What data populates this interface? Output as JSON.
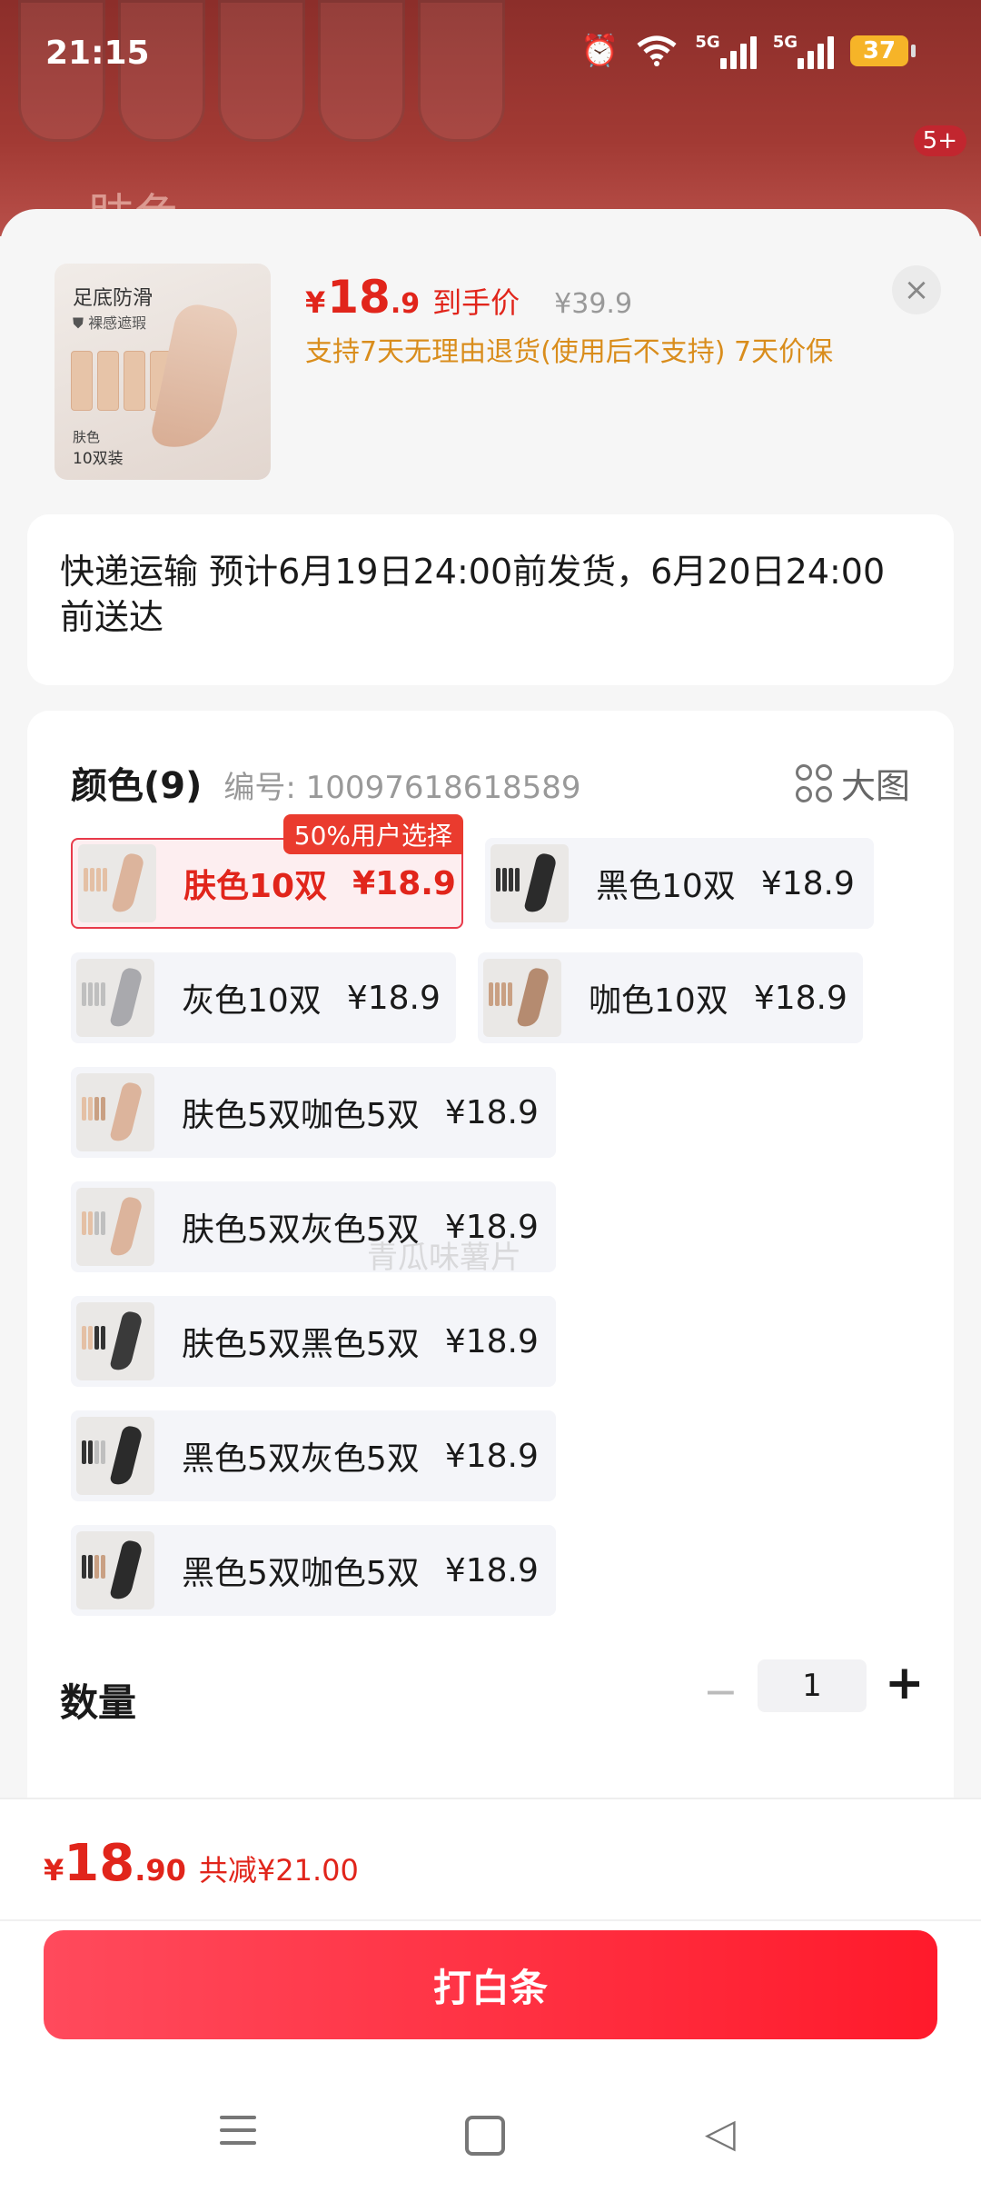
{
  "status_bar": {
    "time": "21:15",
    "signal_label": "5G",
    "battery": "37"
  },
  "background": {
    "color_text": "肤色",
    "badge": "5+"
  },
  "product": {
    "image": {
      "title": "足底防滑",
      "subtitle": "裸感遮瑕",
      "color": "肤色",
      "pack": "10双装"
    },
    "price_symbol": "¥",
    "price_int": "18",
    "price_dec": ".9",
    "price_label": "到手价",
    "original_price": "¥39.9",
    "policy": "支持7天无理由退货(使用后不支持) 7天价保",
    "close_icon": "×"
  },
  "delivery": {
    "text": "快递运输 预计6月19日24:00前发货，6月20日24:00前送达"
  },
  "options": {
    "title": "颜色(9)",
    "code": "编号: 10097618618589",
    "big_pic_label": "大图",
    "badge": "50%用户选择",
    "items": [
      {
        "label": "肤色10双",
        "price": "¥18.9",
        "selected": true
      },
      {
        "label": "黑色10双",
        "price": "¥18.9",
        "selected": false
      },
      {
        "label": "灰色10双",
        "price": "¥18.9",
        "selected": false
      },
      {
        "label": "咖色10双",
        "price": "¥18.9",
        "selected": false
      },
      {
        "label": "肤色5双咖色5双",
        "price": "¥18.9",
        "selected": false
      },
      {
        "label": "肤色5双灰色5双",
        "price": "¥18.9",
        "selected": false
      },
      {
        "label": "肤色5双黑色5双",
        "price": "¥18.9",
        "selected": false
      },
      {
        "label": "黑色5双灰色5双",
        "price": "¥18.9",
        "selected": false
      },
      {
        "label": "黑色5双咖色5双",
        "price": "¥18.9",
        "selected": false
      }
    ]
  },
  "quantity": {
    "label": "数量",
    "value": "1",
    "minus": "−",
    "plus": "+"
  },
  "footer": {
    "total_symbol": "¥",
    "total_int": "18",
    "total_dec": ".90",
    "savings": "共减¥21.00",
    "cta": "打白条"
  },
  "watermark": "青瓜味薯片",
  "colors": {
    "accent": "#e1251b",
    "cta_start": "#ff4a5c",
    "cta_end": "#ff1a2b",
    "policy": "#d98d1c",
    "selected_bg": "#fdeef0"
  }
}
